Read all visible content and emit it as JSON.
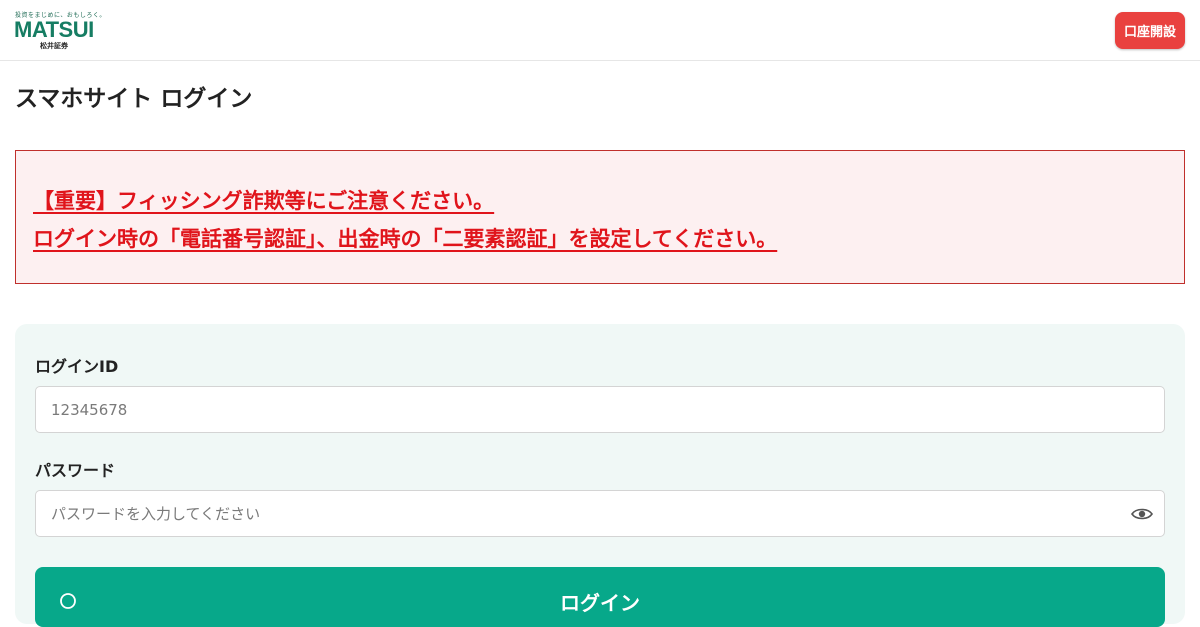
{
  "header": {
    "logo": {
      "tagline": "投資をまじめに、おもしろく。",
      "brand": "MATSUI",
      "sub": "松井証券"
    },
    "open_account_label": "口座開設"
  },
  "page": {
    "title": "スマホサイト ログイン"
  },
  "notice": {
    "line1": "【重要】フィッシング詐欺等にご注意ください。",
    "line2": "ログイン時の「電話番号認証」、出金時の「二要素認証」を設定してください。"
  },
  "form": {
    "login_id": {
      "label": "ログインID",
      "placeholder": "12345678"
    },
    "password": {
      "label": "パスワード",
      "placeholder": "パスワードを入力してください",
      "toggle_icon": "eye-icon"
    },
    "submit_label": "ログイン",
    "submit_icon": "login-icon"
  },
  "colors": {
    "brand_green": "#167d63",
    "login_button": "#07a88a",
    "open_account_button": "#e9413f",
    "notice_text": "#e0141b",
    "notice_border": "#c0302c",
    "notice_background": "#fdf0f1",
    "form_panel_background": "#f0f8f6"
  }
}
